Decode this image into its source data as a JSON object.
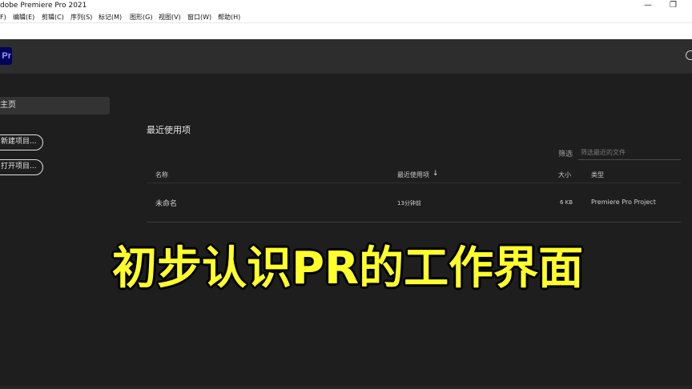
{
  "window": {
    "title": "dobe Premiere Pro 2021",
    "minimize_glyph": "—",
    "restore_glyph": "❐"
  },
  "menu": [
    {
      "label": "F)"
    },
    {
      "label": "编辑(E)"
    },
    {
      "label": "剪辑(C)"
    },
    {
      "label": "序列(S)"
    },
    {
      "label": "标记(M)"
    },
    {
      "label": "图形(G)"
    },
    {
      "label": "视图(V)"
    },
    {
      "label": "窗口(W)"
    },
    {
      "label": "帮助(H)"
    }
  ],
  "header": {
    "logo_text": "Pr",
    "search_icon": "search-icon"
  },
  "sidebar": {
    "home_label": "主页",
    "new_project_label": "新建项目...",
    "open_project_label": "打开项目..."
  },
  "main": {
    "section_title": "最近使用项",
    "filter_label": "筛选",
    "filter_placeholder": "筛选最近的文件",
    "columns": {
      "name": "名称",
      "date": "最近使用项",
      "size": "大小",
      "type": "类型"
    },
    "sort_arrow": "↓",
    "rows": [
      {
        "name": "未命名",
        "date": "13分钟前",
        "size": "6 KB",
        "type": "Premiere Pro Project"
      }
    ]
  },
  "overlay": {
    "caption": "初步认识PR的工作界面",
    "caption_color": "#ffff2b"
  },
  "colors": {
    "background": "#1e1e1e",
    "header": "#2d2d2d",
    "logo_bg": "#00005b",
    "logo_text": "#9999ff"
  }
}
